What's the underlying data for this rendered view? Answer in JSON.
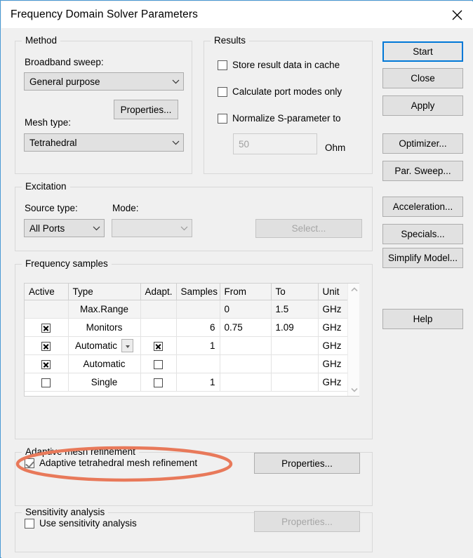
{
  "window": {
    "title": "Frequency Domain Solver Parameters",
    "close_icon": "close-icon",
    "border_color": "#4a9ad4"
  },
  "method": {
    "group_label": "Method",
    "broadband_label": "Broadband sweep:",
    "broadband_value": "General purpose",
    "properties_label": "Properties...",
    "mesh_label": "Mesh type:",
    "mesh_value": "Tetrahedral"
  },
  "results": {
    "group_label": "Results",
    "store_cache_label": "Store result data in cache",
    "store_cache_checked": false,
    "port_modes_label": "Calculate port modes only",
    "port_modes_checked": false,
    "normalize_label": "Normalize S-parameter to",
    "normalize_checked": false,
    "impedance_value": "50",
    "impedance_unit": "Ohm"
  },
  "excitation": {
    "group_label": "Excitation",
    "source_type_label": "Source type:",
    "source_type_value": "All Ports",
    "mode_label": "Mode:",
    "mode_value": "",
    "select_label": "Select..."
  },
  "frequency_samples": {
    "group_label": "Frequency samples",
    "columns": [
      "Active",
      "Type",
      "Adapt.",
      "Samples",
      "From",
      "To",
      "Unit"
    ],
    "rows": [
      {
        "active": "",
        "type": "Max.Range",
        "adapt": "",
        "samples": "",
        "from": "0",
        "to": "1.5",
        "unit": "GHz"
      },
      {
        "active": "x",
        "type": "Monitors",
        "adapt": "",
        "samples": "6",
        "from": "0.75",
        "to": "1.09",
        "unit": "GHz"
      },
      {
        "active": "x",
        "type": "Automatic",
        "adapt": "x",
        "samples": "1",
        "from": "",
        "to": "",
        "unit": "GHz"
      },
      {
        "active": "x",
        "type": "Automatic",
        "adapt": "off",
        "samples": "",
        "from": "",
        "to": "",
        "unit": "GHz"
      },
      {
        "active": "off",
        "type": "Single",
        "adapt": "off",
        "samples": "1",
        "from": "",
        "to": "",
        "unit": "GHz"
      }
    ],
    "scroll_up_icon": "chevron-up-icon",
    "scroll_down_icon": "chevron-down-icon"
  },
  "adaptive_mesh": {
    "group_label": "Adaptive mesh refinement",
    "checkbox_label": "Adaptive tetrahedral mesh refinement",
    "checkbox_checked": true,
    "properties_label": "Properties...",
    "highlight_color": "#e8795a"
  },
  "sensitivity": {
    "group_label": "Sensitivity analysis",
    "checkbox_label": "Use sensitivity analysis",
    "checkbox_checked": false,
    "properties_label": "Properties..."
  },
  "buttons": {
    "start": "Start",
    "close": "Close",
    "apply": "Apply",
    "optimizer": "Optimizer...",
    "par_sweep": "Par. Sweep...",
    "acceleration": "Acceleration...",
    "specials": "Specials...",
    "simplify_model": "Simplify Model...",
    "help": "Help"
  }
}
